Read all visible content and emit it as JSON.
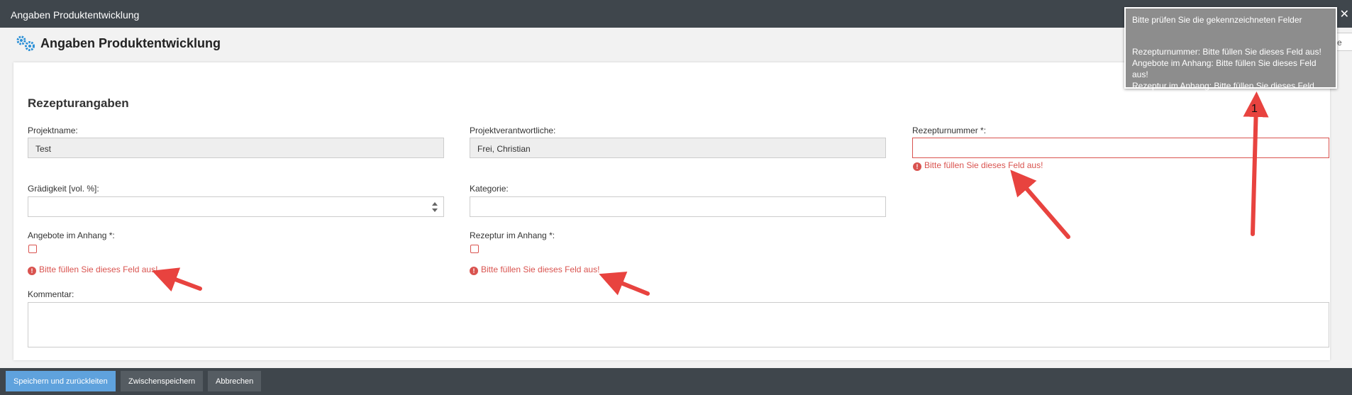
{
  "window": {
    "title": "Angaben Produktentwicklung",
    "close_glyph": "✕"
  },
  "header": {
    "title": "Angaben Produktentwicklung",
    "tab_stub": "e"
  },
  "form": {
    "section_title": "Rezepturangaben",
    "projektname": {
      "label": "Projektname:",
      "value": "Test"
    },
    "projektverantwortliche": {
      "label": "Projektverantwortliche:",
      "value": "Frei, Christian"
    },
    "rezepturnummer": {
      "label": "Rezepturnummer *:",
      "value": "",
      "error": "Bitte füllen Sie dieses Feld aus!"
    },
    "graedigkeit": {
      "label": "Grädigkeit [vol. %]:",
      "value": ""
    },
    "kategorie": {
      "label": "Kategorie:",
      "value": ""
    },
    "angebote": {
      "label": "Angebote im Anhang *:",
      "error": "Bitte füllen Sie dieses Feld aus!"
    },
    "rezeptur_anhang": {
      "label": "Rezeptur im Anhang *:",
      "error": "Bitte füllen Sie dieses Feld aus!"
    },
    "kommentar": {
      "label": "Kommentar:"
    },
    "error_icon": "!"
  },
  "footer": {
    "save_forward": "Speichern und zurückleiten",
    "save_draft": "Zwischenspeichern",
    "cancel": "Abbrechen"
  },
  "toast": {
    "heading": "Bitte prüfen Sie die gekennzeichneten Felder",
    "lines": [
      "Rezepturnummer: Bitte füllen Sie dieses Feld aus!",
      "Angebote im Anhang: Bitte füllen Sie dieses Feld aus!",
      "Rezeptur im Anhang: Bitte füllen Sie dieses Feld aus!"
    ]
  },
  "annotation": {
    "number": "1"
  },
  "colors": {
    "error": "#d9534f",
    "primary": "#5fa2dd",
    "dark": "#3f464c",
    "arrow": "#e8433f"
  }
}
